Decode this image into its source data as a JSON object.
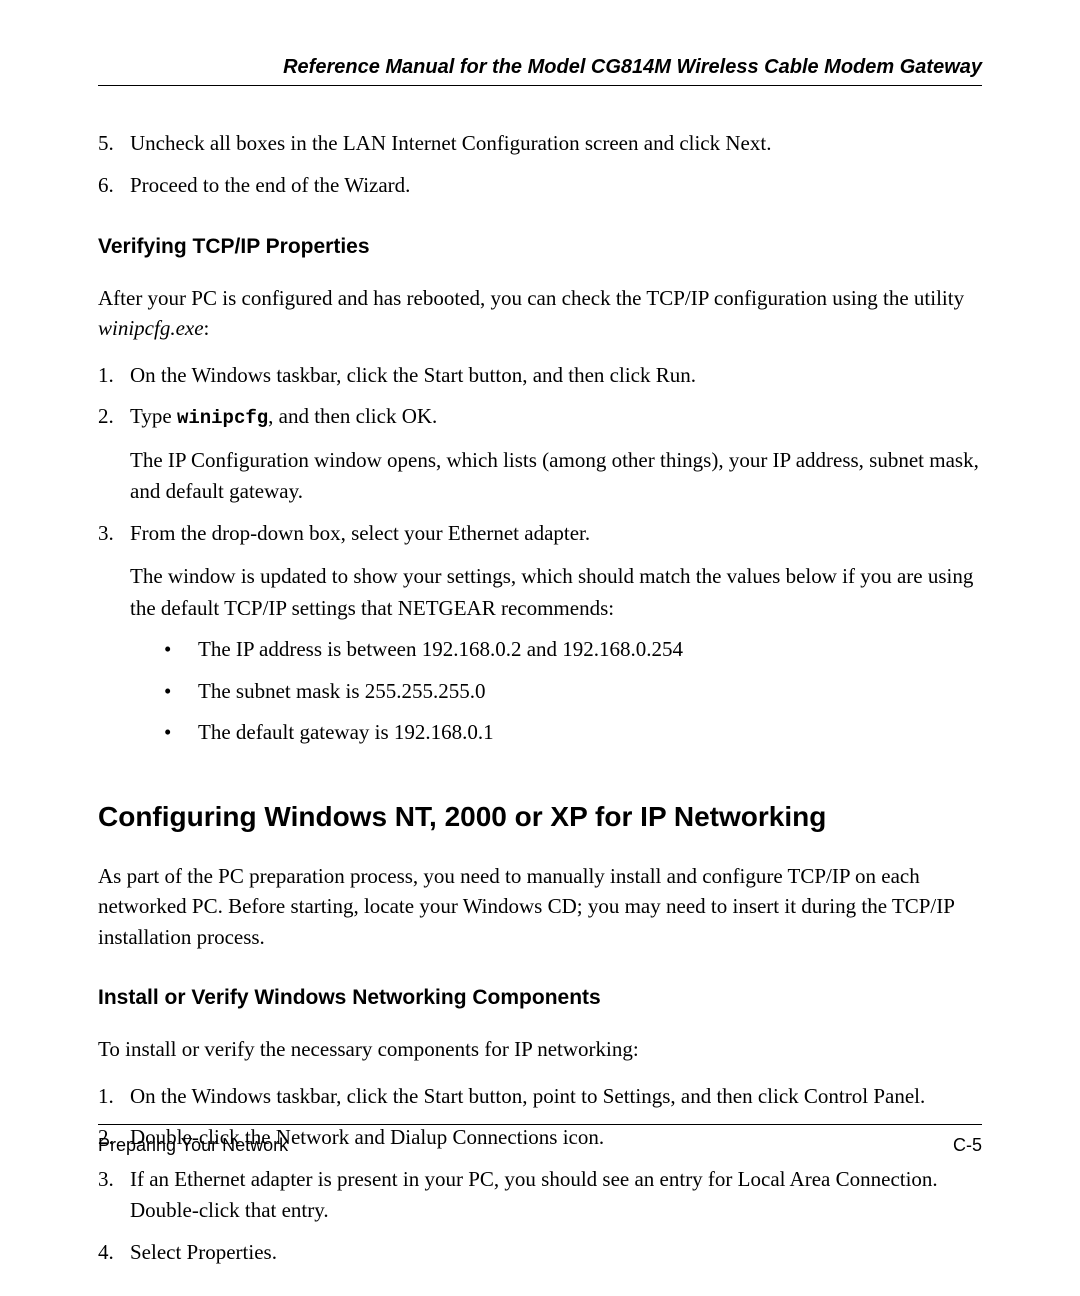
{
  "header": {
    "title": "Reference Manual for the Model CG814M Wireless Cable Modem Gateway"
  },
  "section1": {
    "steps": [
      {
        "number": "5.",
        "text": "Uncheck all boxes in the LAN Internet Configuration screen and click Next."
      },
      {
        "number": "6.",
        "text": "Proceed to the end of the Wizard."
      }
    ]
  },
  "section2": {
    "heading": "Verifying TCP/IP Properties",
    "intro_prefix": "After your PC is configured and has rebooted, you can check the TCP/IP configuration using the utility ",
    "intro_italic": "winipcfg.exe",
    "intro_suffix": ":",
    "steps": {
      "s1": {
        "number": "1.",
        "text": "On the Windows taskbar, click the Start button, and then click Run."
      },
      "s2": {
        "number": "2.",
        "prefix": "Type ",
        "mono": "winipcfg",
        "suffix": ", and then click OK.",
        "para": "The IP Configuration window opens, which lists (among other things), your IP address, subnet mask, and default gateway."
      },
      "s3": {
        "number": "3.",
        "text": "From the drop-down box, select your Ethernet adapter.",
        "para": "The window is updated to show your settings, which should match the values below if you are using the default TCP/IP settings that NETGEAR recommends:",
        "bullets": [
          "The IP address is between 192.168.0.2 and 192.168.0.254",
          "The subnet mask is 255.255.255.0",
          "The default gateway is 192.168.0.1"
        ]
      }
    }
  },
  "section3": {
    "heading": "Configuring Windows NT, 2000 or XP for IP Networking",
    "intro": "As part of the PC preparation process, you need to manually install and configure TCP/IP on each networked PC. Before starting, locate your Windows CD; you may need to insert it during the TCP/IP installation process."
  },
  "section4": {
    "heading": "Install or Verify Windows Networking Components",
    "intro": "To install or verify the necessary components for IP networking:",
    "steps": [
      {
        "number": "1.",
        "text": "On the Windows taskbar, click the Start button, point to Settings, and then click Control Panel."
      },
      {
        "number": "2.",
        "text": "Double-click the Network and Dialup Connections icon."
      },
      {
        "number": "3.",
        "text": "If an Ethernet adapter is present in your PC, you should see an entry for Local Area Connection. Double-click that entry."
      },
      {
        "number": "4.",
        "text": "Select Properties."
      }
    ]
  },
  "footer": {
    "left": "Preparing Your Network",
    "right": "C-5"
  }
}
